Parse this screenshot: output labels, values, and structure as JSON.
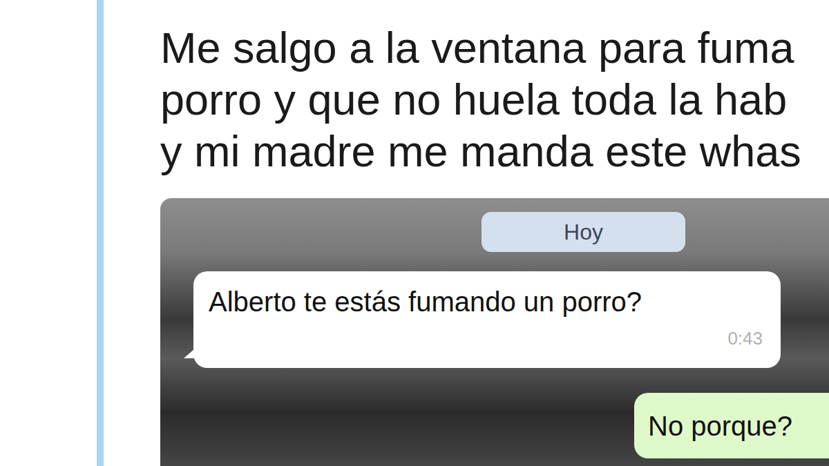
{
  "tweet": {
    "text_lines": [
      "Me salgo a la ventana para fuma",
      "porro y que no huela toda la hab",
      "y mi madre me manda este whas"
    ]
  },
  "chat": {
    "date_badge": "Hoy",
    "messages": [
      {
        "kind": "incoming",
        "text": "Alberto te estás fumando un porro?",
        "time": "0:43"
      },
      {
        "kind": "outgoing",
        "text": "No porque?"
      }
    ]
  }
}
